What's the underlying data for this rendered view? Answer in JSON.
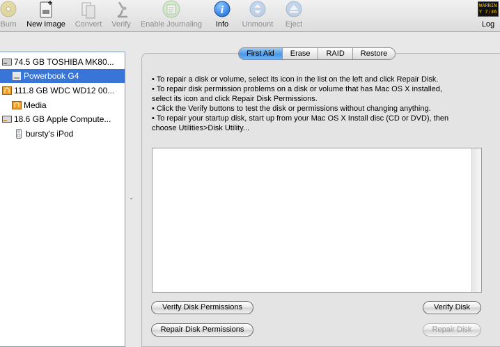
{
  "toolbar": {
    "items": [
      {
        "label": "Burn",
        "icon": "burn-icon",
        "enabled": false
      },
      {
        "label": "New Image",
        "icon": "new-image-icon",
        "enabled": true
      },
      {
        "label": "Convert",
        "icon": "convert-icon",
        "enabled": false
      },
      {
        "label": "Verify",
        "icon": "verify-microscope-icon",
        "enabled": false
      },
      {
        "label": "Enable Journaling",
        "icon": "journaling-icon",
        "enabled": false
      },
      {
        "label": "Info",
        "icon": "info-icon",
        "enabled": true
      },
      {
        "label": "Unmount",
        "icon": "unmount-icon",
        "enabled": false
      },
      {
        "label": "Eject",
        "icon": "eject-icon",
        "enabled": false
      },
      {
        "label": "Log",
        "icon": "log-console-icon",
        "enabled": true
      }
    ],
    "log_badge_line1": "WARNIN",
    "log_badge_line2": "Y 7:36"
  },
  "sidebar": {
    "items": [
      {
        "label": "74.5 GB TOSHIBA MK80...",
        "icon": "internal-disk-icon",
        "indent": 0,
        "selected": false
      },
      {
        "label": "Powerbook G4",
        "icon": "volume-icon",
        "indent": 1,
        "selected": true
      },
      {
        "label": "111.8 GB WDC WD12 00...",
        "icon": "firewire-disk-icon",
        "indent": 0,
        "selected": false
      },
      {
        "label": "Media",
        "icon": "firewire-volume-icon",
        "indent": 1,
        "selected": false
      },
      {
        "label": "18.6 GB Apple Compute...",
        "icon": "external-disk-icon",
        "indent": 0,
        "selected": false
      },
      {
        "label": "bursty's iPod",
        "icon": "ipod-icon",
        "indent": 1,
        "selected": false
      }
    ]
  },
  "tabs": [
    {
      "label": "First Aid",
      "active": true
    },
    {
      "label": "Erase",
      "active": false
    },
    {
      "label": "RAID",
      "active": false
    },
    {
      "label": "Restore",
      "active": false
    }
  ],
  "first_aid": {
    "instructions": [
      "• To repair a disk or volume, select its icon in the list on the left and click Repair Disk.",
      "• To repair disk permission problems on a disk or volume that has Mac OS X installed,",
      "select its icon and click Repair Disk Permissions.",
      "• Click the Verify buttons to test the disk or permissions without changing anything.",
      "• To repair your startup disk, start up from your Mac OS X Install disc (CD or DVD), then",
      "choose Utilities>Disk Utility..."
    ],
    "buttons": {
      "verify_permissions": "Verify Disk Permissions",
      "repair_permissions": "Repair Disk Permissions",
      "verify_disk": "Verify Disk",
      "repair_disk": "Repair Disk"
    }
  },
  "colors": {
    "selection": "#3875d7",
    "tab_active": "#6aaef0",
    "info_blue": "#1d6fd8"
  }
}
